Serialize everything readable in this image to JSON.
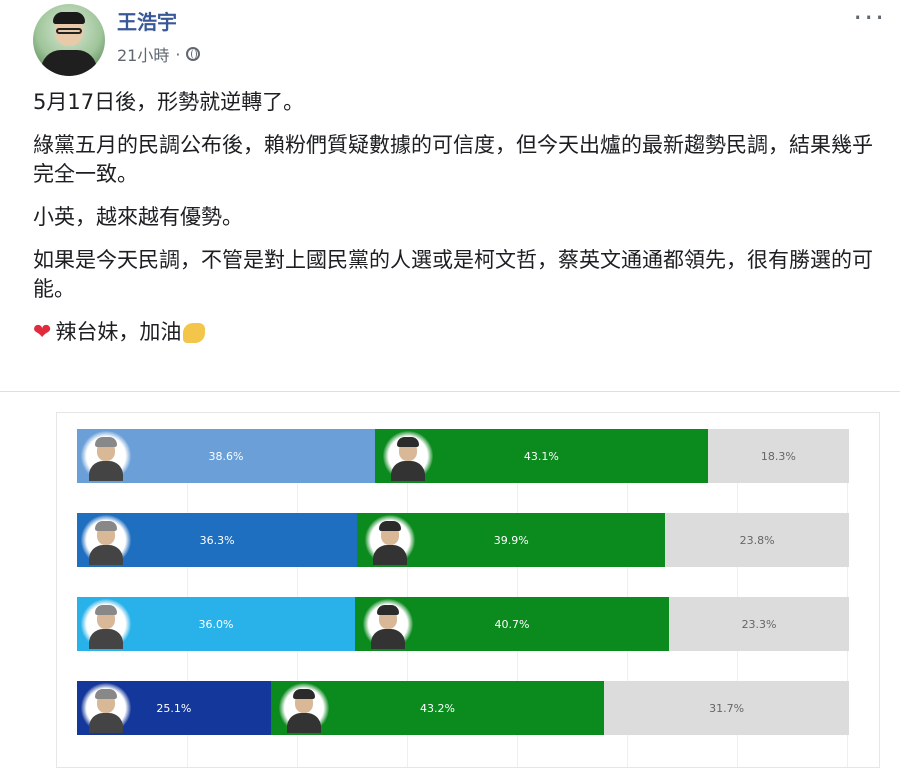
{
  "post": {
    "author": "王浩宇",
    "timestamp": "21小時",
    "paragraphs": [
      "5月17日後，形勢就逆轉了。",
      "綠黨五月的民調公布後，賴粉們質疑數據的可信度，但今天出爐的最新趨勢民調，結果幾乎完全一致。",
      "小英，越來越有優勢。",
      "如果是今天民調，不管是對上國民黨的人選或是柯文哲，蔡英文通通都領先，很有勝選的可能。"
    ],
    "closing": "辣台妹，加油",
    "icons": {
      "more": "more-options-icon",
      "privacy": "globe-icon",
      "heart": "heart-icon",
      "flex": "flexed-biceps-icon"
    }
  },
  "chart_data": {
    "type": "bar",
    "stacked": true,
    "orientation": "horizontal",
    "grid": true,
    "rows": [
      {
        "opponent": 38.6,
        "tsai": 43.1,
        "undecided": 18.3,
        "labels": {
          "opponent": "38.6%",
          "tsai": "43.1%",
          "undecided": "18.3%"
        },
        "opponent_color": "#6a9fd8"
      },
      {
        "opponent": 36.3,
        "tsai": 39.9,
        "undecided": 23.8,
        "labels": {
          "opponent": "36.3%",
          "tsai": "39.9%",
          "undecided": "23.8%"
        },
        "opponent_color": "#1f6fc0"
      },
      {
        "opponent": 36.0,
        "tsai": 40.7,
        "undecided": 23.3,
        "labels": {
          "opponent": "36.0%",
          "tsai": "40.7%",
          "undecided": "23.3%"
        },
        "opponent_color": "#29b2ea"
      },
      {
        "opponent": 25.1,
        "tsai": 43.2,
        "undecided": 31.7,
        "labels": {
          "opponent": "25.1%",
          "tsai": "43.2%",
          "undecided": "31.7%"
        },
        "opponent_color": "#13379a"
      }
    ],
    "colors": {
      "tsai": "#0b8a1e",
      "undecided": "#dcdcdc"
    }
  }
}
